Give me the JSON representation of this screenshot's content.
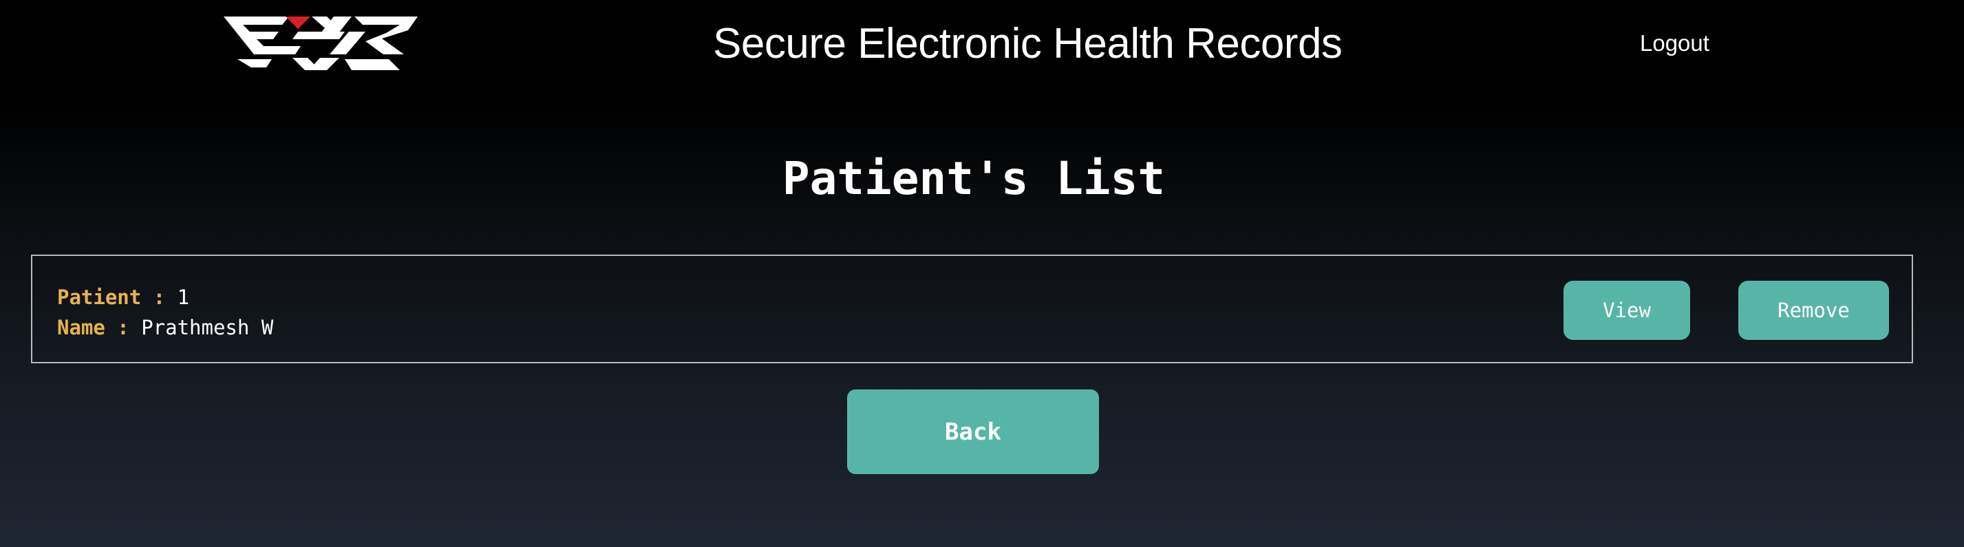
{
  "header": {
    "logo_alt": "EHR",
    "app_title": "Secure Electronic Health Records",
    "logout_label": "Logout"
  },
  "main": {
    "page_title": "Patient's List",
    "patients": [
      {
        "patient_label": "Patient :",
        "patient_id": "1",
        "name_label": "Name :",
        "name": "Prathmesh W",
        "view_label": "View",
        "remove_label": "Remove"
      }
    ],
    "back_label": "Back"
  },
  "colors": {
    "accent": "#57b5a7",
    "label": "#e8b448",
    "logo_red": "#d8202a",
    "background_top": "#000000",
    "background_bottom": "#1f2633"
  }
}
